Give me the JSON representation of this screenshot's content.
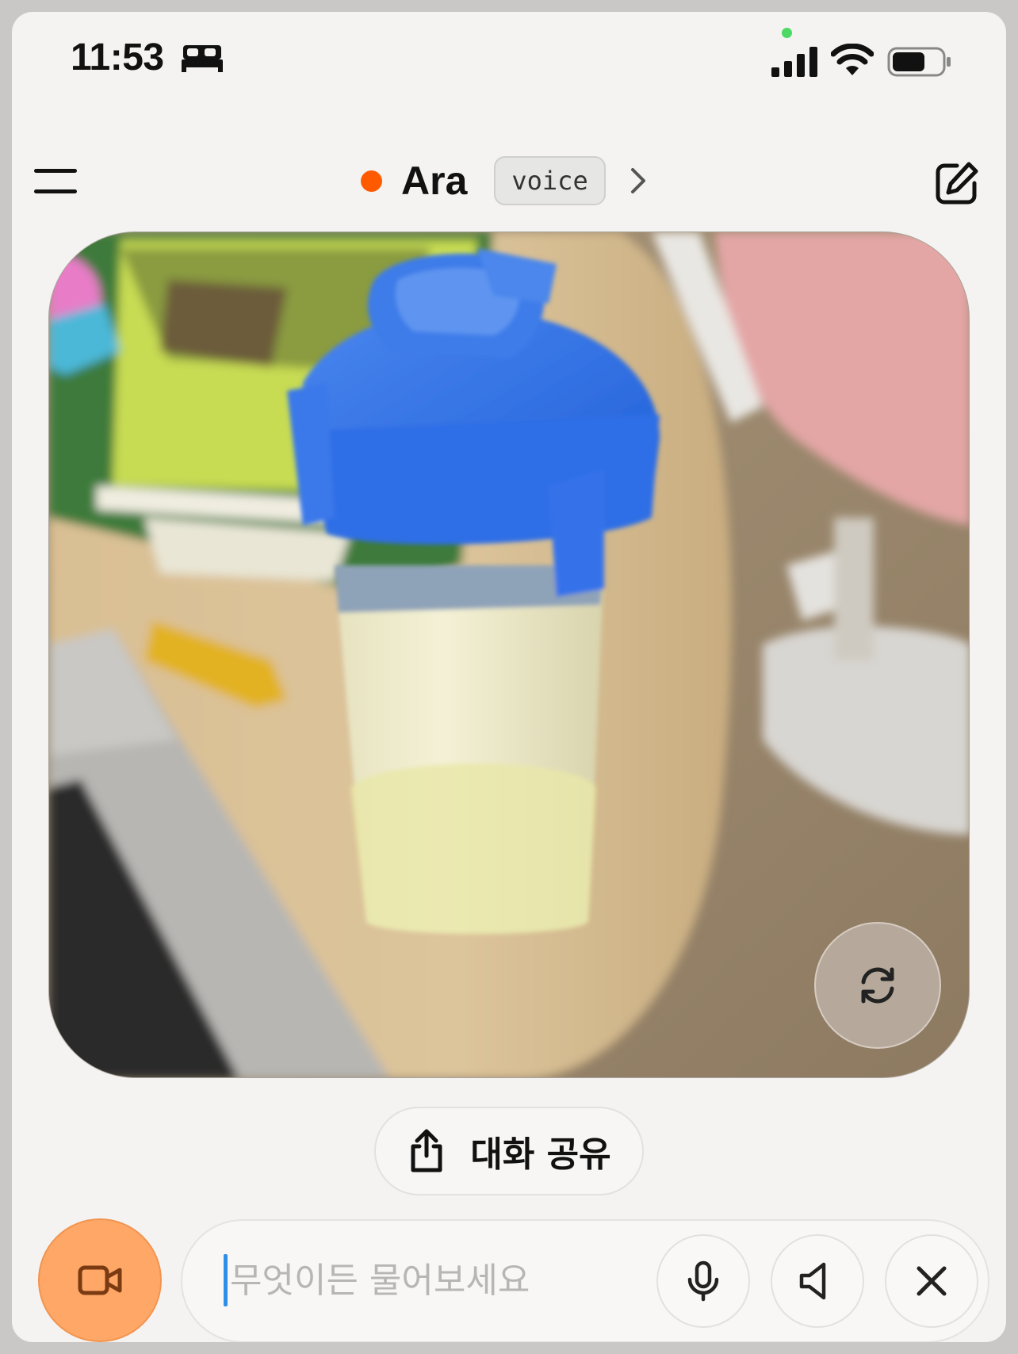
{
  "status_bar": {
    "time": "11:53",
    "camera_indicator_color": "#4cd964"
  },
  "header": {
    "assistant_name": "Ara",
    "mode_badge": "voice",
    "status_color": "#ff5a00"
  },
  "share": {
    "label": "대화 공유"
  },
  "composer": {
    "placeholder": "무엇이든 물어보세요",
    "value": ""
  },
  "colors": {
    "video_button": "#ffa766",
    "background": "#f4f3f1"
  },
  "icons": [
    "sleep-icon",
    "signal-icon",
    "wifi-icon",
    "battery-icon",
    "menu-icon",
    "chevron-right-icon",
    "edit-icon",
    "flip-camera-icon",
    "share-icon",
    "video-camera-icon",
    "microphone-icon",
    "speaker-icon",
    "close-icon"
  ]
}
